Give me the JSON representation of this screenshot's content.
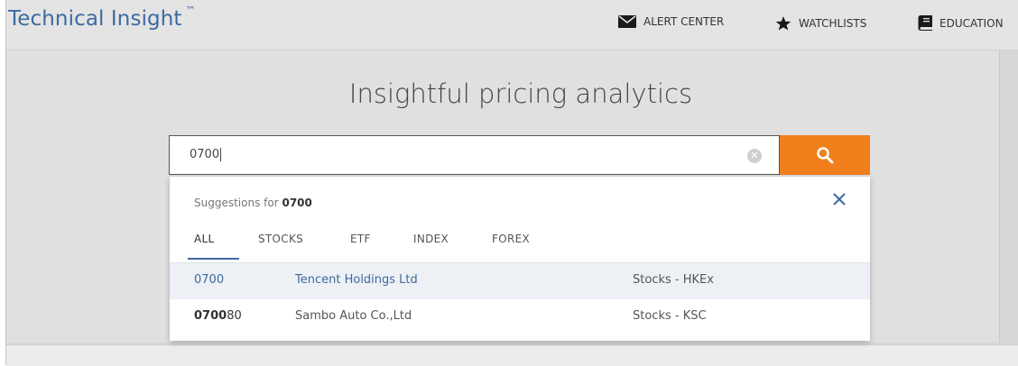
{
  "header": {
    "brand": "Technical Insight",
    "trademark": "™",
    "nav": [
      {
        "label": "ALERT CENTER",
        "icon": "envelope-icon"
      },
      {
        "label": "WATCHLISTS",
        "icon": "star-icon"
      },
      {
        "label": "EDUCATION",
        "icon": "book-icon"
      }
    ]
  },
  "hero": {
    "title": "Insightful pricing analytics"
  },
  "search": {
    "value": "0700",
    "clear_icon": "clear-circle-icon",
    "button_icon": "search-icon"
  },
  "suggestions": {
    "prefix": "Suggestions for",
    "query": "0700",
    "tabs": [
      "ALL",
      "STOCKS",
      "ETF",
      "INDEX",
      "FOREX"
    ],
    "active_tab": "ALL",
    "results": [
      {
        "symbol": "0700",
        "name": "Tencent Holdings Ltd",
        "type": "Stocks - HKEx"
      },
      {
        "symbol_match": "0700",
        "symbol_rest": "80",
        "name": "Sambo Auto Co.,Ltd",
        "type": "Stocks - KSC"
      }
    ]
  },
  "colors": {
    "brand_blue": "#3d6aa0",
    "search_orange": "#f07f1c",
    "background_gray": "#e0e0e0"
  }
}
